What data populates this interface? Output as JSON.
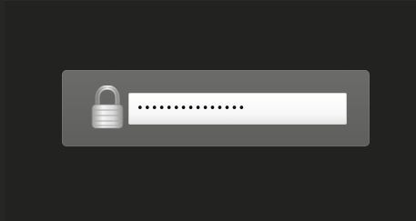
{
  "unlock_panel": {
    "icon": "padlock-icon",
    "password_field": {
      "value": "•••••••••••••••"
    }
  },
  "colors": {
    "background": "#222221",
    "panel": "#656563",
    "field": "#ffffff"
  }
}
